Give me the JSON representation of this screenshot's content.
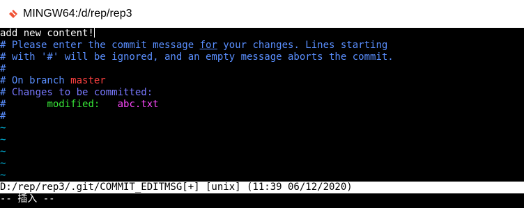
{
  "window": {
    "title": "MINGW64:/d/rep/rep3",
    "icon": "git-bash-icon"
  },
  "editor": {
    "lines": [
      {
        "text": "add new content!",
        "color": "white"
      },
      {
        "parts": [
          "# Please enter the commit message ",
          "for",
          " your changes. Lines starting"
        ],
        "color": "blue"
      },
      {
        "text": "# with '#' will be ignored, and an empty message aborts the commit.",
        "color": "blue"
      },
      {
        "text": "#",
        "color": "blue"
      },
      {
        "prefix": "# On branch ",
        "branch": "master"
      },
      {
        "prefix": "# ",
        "label": "Changes to be committed:"
      },
      {
        "prefix": "#",
        "indent": "       ",
        "status": "modified:",
        "gap": "   ",
        "file": "abc.txt"
      },
      {
        "text": "#",
        "color": "blue"
      }
    ],
    "tildes": [
      "~",
      "~",
      "~",
      "~",
      "~",
      "~"
    ]
  },
  "status_line": {
    "text": "D:/rep/rep3/.git/COMMIT_EDITMSG[+] [unix] (11:39 06/12/2020)"
  },
  "mode_line": {
    "text": "-- 插入 --"
  },
  "colors": {
    "background": "#000000",
    "comment": "#5a8fff",
    "branch": "#ff4040",
    "section": "#7878ff",
    "status": "#38e838",
    "filename": "#ff49ff",
    "tilde": "#00b4dc",
    "statusbar_bg": "#ffffff"
  }
}
